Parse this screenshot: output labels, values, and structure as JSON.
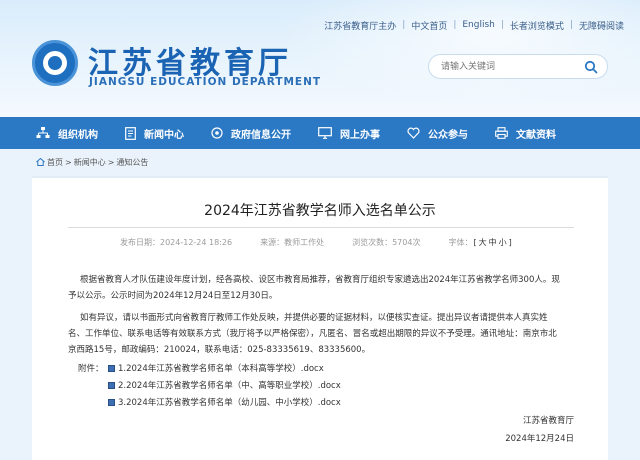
{
  "header": {
    "top_links": [
      "江苏省教育厅主办",
      "中文首页",
      "English",
      "长者浏览模式",
      "无障碍阅读"
    ],
    "site_title": "江苏省教育厅",
    "site_subtitle": "JIANGSU EDUCATION DEPARTMENT",
    "search_placeholder": "请输入关键词"
  },
  "nav": {
    "items": [
      {
        "label": "组织机构",
        "icon": "org-chart-icon"
      },
      {
        "label": "新闻中心",
        "icon": "document-icon"
      },
      {
        "label": "政府信息公开",
        "icon": "target-icon"
      },
      {
        "label": "网上办事",
        "icon": "monitor-icon"
      },
      {
        "label": "公众参与",
        "icon": "heart-icon"
      },
      {
        "label": "文献资料",
        "icon": "printer-icon"
      }
    ]
  },
  "breadcrumb": {
    "home": "首页",
    "sep": ">",
    "level1": "新闻中心",
    "level2": "通知公告"
  },
  "article": {
    "title": "2024年江苏省教学名师入选名单公示",
    "meta": {
      "date": "发布日期：2024-12-24 18:26",
      "source": "来源：教师工作处",
      "views": "浏览次数：5704次",
      "font_label": "字体：",
      "font_big": "大",
      "font_mid": "中",
      "font_small": "小"
    },
    "para1_line1": "根据省教育人才队伍建设年度计划，经各高校、设区市教育局推荐，省教育厅组织专家遴选出2024年江苏省教学名师300人。现",
    "para1_line2": "予以公示。公示时间为2024年12月24日至12月30日。",
    "para2_line1": "如有异议，请以书面形式向省教育厅教师工作处反映，并提供必要的证据材料，以便核实查证。提出异议者请提供本人真实姓",
    "para2_line2": "名、工作单位、联系电话等有效联系方式（我厅将予以严格保密），凡匿名、冒名或超出期限的异议不予受理。通讯地址：南京市北",
    "para2_line3": "京西路15号，邮政编码：210024，联系电话：025-83335619、83335600。",
    "attachments_label": "附件：",
    "attachments": [
      "1.2024年江苏省教学名师名单（本科高等学校）.docx",
      "2.2024年江苏省教学名师名单（中、高等职业学校）.docx",
      "3.2024年江苏省教学名师名单（幼儿园、中小学校）.docx"
    ],
    "signature_org": "江苏省教育厅",
    "signature_date": "2024年12月24日"
  },
  "colors": {
    "nav_bg": "#2b78c4",
    "brand_blue": "#1b63b3",
    "page_bg": "#eaf3fb"
  }
}
